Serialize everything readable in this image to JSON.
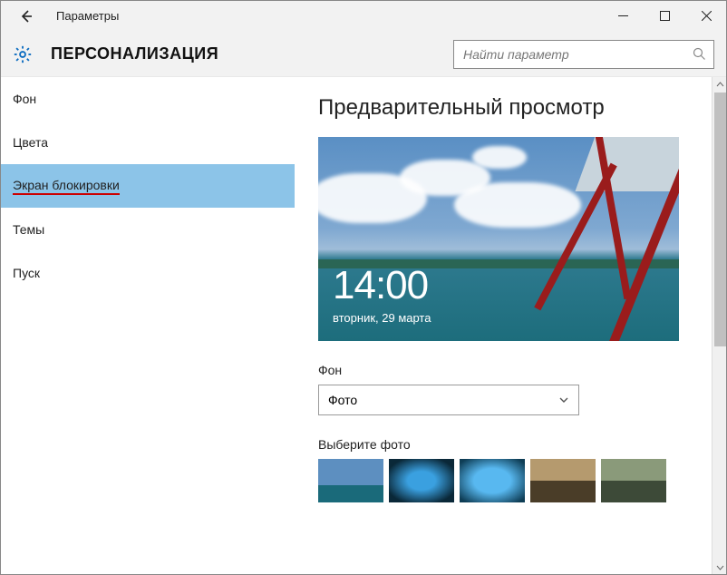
{
  "titlebar": {
    "app_title": "Параметры"
  },
  "header": {
    "category": "ПЕРСОНАЛИЗАЦИЯ",
    "search_placeholder": "Найти параметр"
  },
  "sidebar": {
    "items": [
      {
        "label": "Фон"
      },
      {
        "label": "Цвета"
      },
      {
        "label": "Экран блокировки"
      },
      {
        "label": "Темы"
      },
      {
        "label": "Пуск"
      }
    ]
  },
  "content": {
    "preview_heading": "Предварительный просмотр",
    "lock_time": "14:00",
    "lock_date": "вторник, 29 марта",
    "background_label": "Фон",
    "background_dropdown_value": "Фото",
    "choose_photo_label": "Выберите фото"
  }
}
